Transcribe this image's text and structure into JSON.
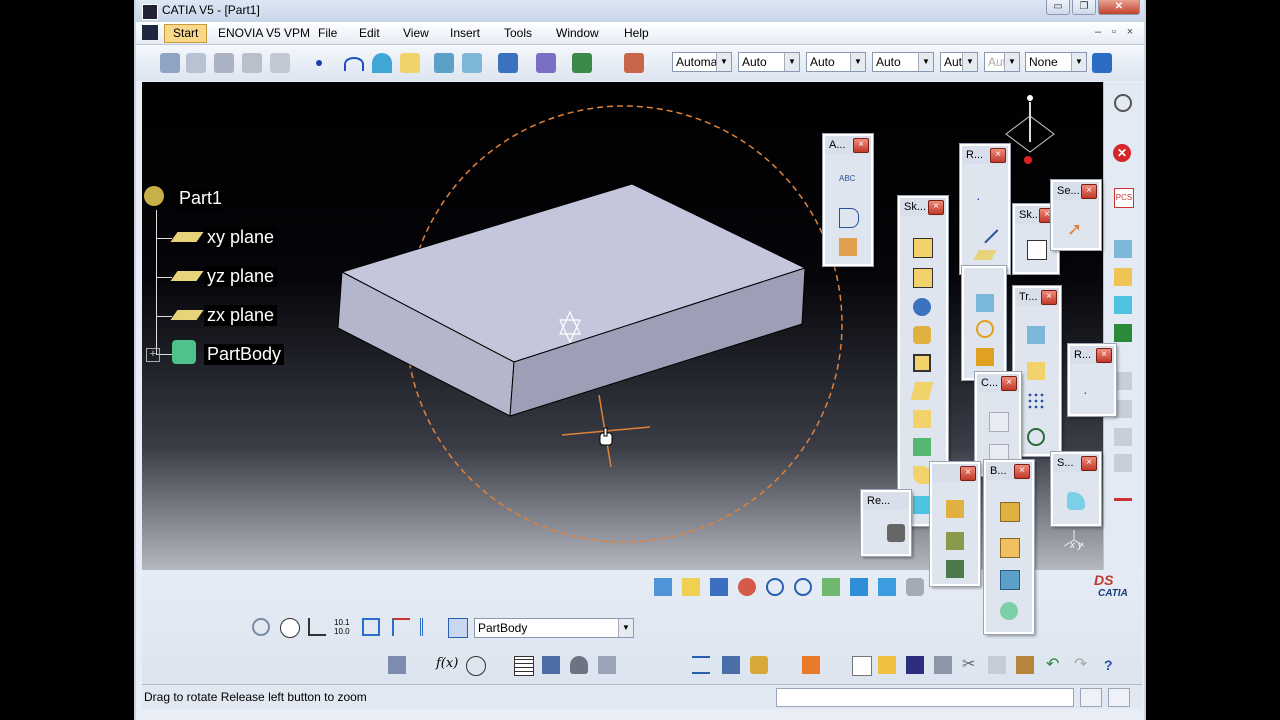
{
  "window": {
    "title": "CATIA V5 - [Part1]",
    "min": "▭",
    "max": "❐",
    "close": "✕"
  },
  "menu": {
    "items": [
      "Start",
      "ENOVIA V5 VPM",
      "File",
      "Edit",
      "View",
      "Insert",
      "Tools",
      "Window",
      "Help"
    ],
    "mdi": {
      "min": "–",
      "restore": "▫",
      "close": "×"
    }
  },
  "toolbar_combos": {
    "c1": "Automa",
    "c2": "Auto",
    "c3": "Auto",
    "c4": "Auto",
    "c5": "Aut",
    "c6": "Aut",
    "c7": "None"
  },
  "tree": {
    "root": "Part1",
    "children": [
      "xy plane",
      "yz plane",
      "zx plane",
      "PartBody"
    ]
  },
  "panels": {
    "annotations": "A...",
    "sketch_tools": "Sk...",
    "reference": "R...",
    "sketch": "Sk...",
    "select": "Se...",
    "transform": "Tr...",
    "ref2": "R...",
    "constraints": "C...",
    "boolean": "B...",
    "surface": "S...",
    "render": "Re..."
  },
  "lower": {
    "partbody_combo": "PartBody"
  },
  "status": {
    "text": "Drag to rotate  Release left button to zoom"
  },
  "brand": {
    "logo": "DS",
    "name": "CATIA"
  },
  "compass": {
    "axes": "x y"
  },
  "colors": {
    "viewport_bg": "#000000",
    "solid_top": "#c4c6dc",
    "solid_side": "#9d9fb6",
    "circle": "#e0823a",
    "close_red": "#c0392b"
  },
  "icons": [
    "gear-icon",
    "stop-icon",
    "pcs-icon",
    "pad-icon",
    "pocket-icon",
    "shaft-icon",
    "groove-icon",
    "hole-icon",
    "rib-icon",
    "slot-icon",
    "stiffener-icon",
    "loft-icon",
    "pan-icon",
    "rotate-icon",
    "zoom-in-icon",
    "zoom-out-icon",
    "fit-all-icon",
    "normal-view-icon",
    "iso-view-icon",
    "render-icon",
    "new-icon",
    "open-icon",
    "save-icon",
    "print-icon",
    "cut-icon",
    "copy-icon",
    "paste-icon",
    "undo-icon",
    "redo-icon",
    "help-icon"
  ]
}
